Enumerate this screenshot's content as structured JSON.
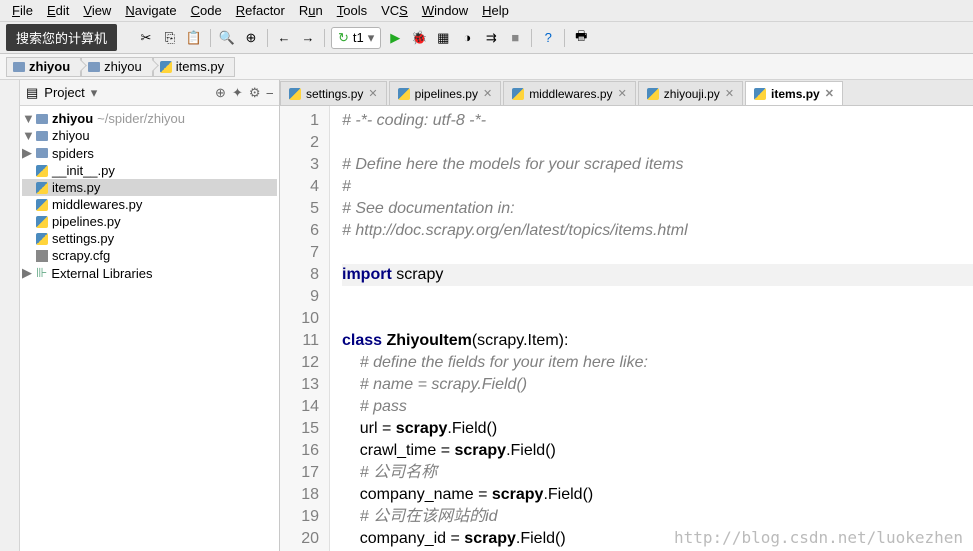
{
  "menu": {
    "file": "File",
    "edit": "Edit",
    "view": "View",
    "navigate": "Navigate",
    "code": "Code",
    "refactor": "Refactor",
    "run": "Run",
    "tools": "Tools",
    "vcs": "VCS",
    "window": "Window",
    "help": "Help"
  },
  "search_overlay": "搜索您的计算机",
  "run_config": {
    "label": "t1",
    "reload_icon": "↻"
  },
  "breadcrumb": [
    {
      "type": "dir",
      "label": "zhiyou"
    },
    {
      "type": "dir",
      "label": "zhiyou"
    },
    {
      "type": "py",
      "label": "items.py"
    }
  ],
  "project_panel": {
    "title": "Project",
    "tools": [
      "⊕",
      "✦",
      "⚙",
      "⎯"
    ]
  },
  "tree": [
    {
      "indent": 0,
      "arrow": "▼",
      "icon": "dir",
      "label": "zhiyou",
      "suffix": "~/spider/zhiyou",
      "bold": true
    },
    {
      "indent": 1,
      "arrow": "▼",
      "icon": "dir",
      "label": "zhiyou"
    },
    {
      "indent": 2,
      "arrow": "▶",
      "icon": "dir",
      "label": "spiders"
    },
    {
      "indent": 3,
      "arrow": "",
      "icon": "py",
      "label": "__init__.py"
    },
    {
      "indent": 3,
      "arrow": "",
      "icon": "py",
      "label": "items.py",
      "sel": true
    },
    {
      "indent": 3,
      "arrow": "",
      "icon": "py",
      "label": "middlewares.py"
    },
    {
      "indent": 3,
      "arrow": "",
      "icon": "py",
      "label": "pipelines.py"
    },
    {
      "indent": 3,
      "arrow": "",
      "icon": "py",
      "label": "settings.py"
    },
    {
      "indent": 2,
      "arrow": "",
      "icon": "cfg",
      "label": "scrapy.cfg"
    },
    {
      "indent": 0,
      "arrow": "▶",
      "icon": "lib",
      "label": "External Libraries"
    }
  ],
  "tabs": [
    {
      "label": "settings.py",
      "active": false
    },
    {
      "label": "pipelines.py",
      "active": false
    },
    {
      "label": "middlewares.py",
      "active": false
    },
    {
      "label": "zhiyouji.py",
      "active": false
    },
    {
      "label": "items.py",
      "active": true
    }
  ],
  "editor": {
    "current_line": 8,
    "lines": [
      {
        "n": 1,
        "cls": "cm",
        "text": "# -*- coding: utf-8 -*-"
      },
      {
        "n": 2,
        "cls": "",
        "text": ""
      },
      {
        "n": 3,
        "cls": "cm",
        "text": "# Define here the models for your scraped items"
      },
      {
        "n": 4,
        "cls": "cm",
        "text": "#"
      },
      {
        "n": 5,
        "cls": "cm",
        "text": "# See documentation in:"
      },
      {
        "n": 6,
        "cls": "cm",
        "text": "# http://doc.scrapy.org/en/latest/topics/items.html"
      },
      {
        "n": 7,
        "cls": "",
        "text": ""
      },
      {
        "n": 8,
        "cls": "code",
        "tokens": [
          [
            "kw",
            "import "
          ],
          [
            "id",
            "scrapy"
          ]
        ]
      },
      {
        "n": 9,
        "cls": "",
        "text": ""
      },
      {
        "n": 10,
        "cls": "",
        "text": ""
      },
      {
        "n": 11,
        "cls": "code",
        "tokens": [
          [
            "kw",
            "class "
          ],
          [
            "cn",
            "ZhiyouItem"
          ],
          [
            "id",
            "(scrapy.Item):"
          ]
        ]
      },
      {
        "n": 12,
        "cls": "cm",
        "text": "    # define the fields for your item here like:",
        "pad": 1
      },
      {
        "n": 13,
        "cls": "cm",
        "text": "    # name = scrapy.Field()",
        "pad": 1
      },
      {
        "n": 14,
        "cls": "cm",
        "text": "    # pass",
        "pad": 1
      },
      {
        "n": 15,
        "cls": "code",
        "tokens": [
          [
            "id",
            "    url = "
          ],
          [
            "cn",
            "scrapy"
          ],
          [
            "id",
            ".Field()"
          ]
        ]
      },
      {
        "n": 16,
        "cls": "code",
        "tokens": [
          [
            "id",
            "    crawl_time = "
          ],
          [
            "cn",
            "scrapy"
          ],
          [
            "id",
            ".Field()"
          ]
        ]
      },
      {
        "n": 17,
        "cls": "cm",
        "text": "    # 公司名称",
        "pad": 1
      },
      {
        "n": 18,
        "cls": "code",
        "tokens": [
          [
            "id",
            "    company_name = "
          ],
          [
            "cn",
            "scrapy"
          ],
          [
            "id",
            ".Field()"
          ]
        ]
      },
      {
        "n": 19,
        "cls": "cm",
        "text": "    # 公司在该网站的id",
        "pad": 1
      },
      {
        "n": 20,
        "cls": "code",
        "tokens": [
          [
            "id",
            "    company_id = "
          ],
          [
            "cn",
            "scrapy"
          ],
          [
            "id",
            ".Field()"
          ]
        ]
      }
    ]
  },
  "toolbar_icons": {
    "cut": "✂",
    "copy": "⎘",
    "paste": "📋",
    "find": "🔍",
    "zoom": "⊕",
    "back": "←",
    "fwd": "→",
    "run": "▶",
    "debug": "🐞",
    "cov": "▦",
    "prof": "◑",
    "stop": "■",
    "restart": "↻",
    "help": "?",
    "print": "🖶"
  },
  "watermark": "http://blog.csdn.net/luokezhen"
}
